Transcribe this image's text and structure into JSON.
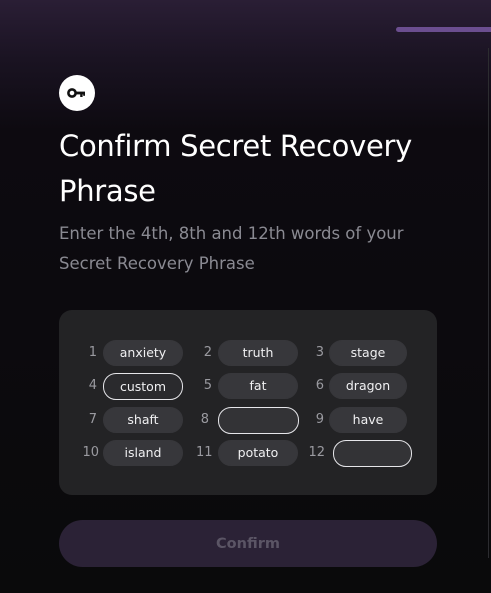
{
  "header": {
    "title": "Confirm Secret Recovery Phrase",
    "subtitle": "Enter the 4th, 8th and 12th words of your Secret Recovery Phrase",
    "progress": 0.2
  },
  "words": [
    {
      "num": "1",
      "word": "anxiety"
    },
    {
      "num": "2",
      "word": "truth"
    },
    {
      "num": "3",
      "word": "stage"
    },
    {
      "num": "4",
      "word": "custom"
    },
    {
      "num": "5",
      "word": "fat"
    },
    {
      "num": "6",
      "word": "dragon"
    },
    {
      "num": "7",
      "word": "shaft"
    },
    {
      "num": "8",
      "word": ""
    },
    {
      "num": "9",
      "word": "have"
    },
    {
      "num": "10",
      "word": "island"
    },
    {
      "num": "11",
      "word": "potato"
    },
    {
      "num": "12",
      "word": ""
    }
  ],
  "confirm_button": {
    "label": "Confirm"
  },
  "icons": {
    "header_icon": "key-icon"
  },
  "colors": {
    "accent": "#6b4e8f",
    "button_disabled_bg": "#2b2236",
    "panel_bg": "#232325"
  }
}
